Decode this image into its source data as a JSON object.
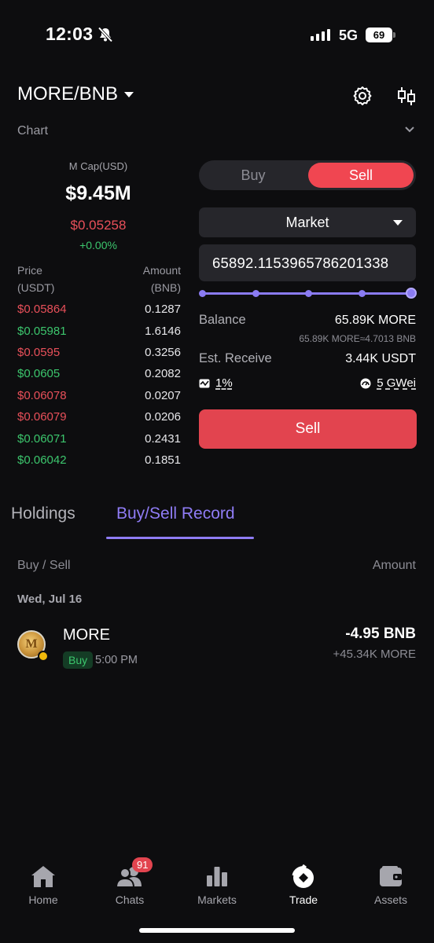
{
  "status_bar": {
    "time": "12:03",
    "network": "5G",
    "battery": "69"
  },
  "header": {
    "pair": "MORE/BNB",
    "chart_label": "Chart"
  },
  "info": {
    "mcap_label": "M Cap(USD)",
    "mcap": "$9.45M",
    "price": "$0.05258",
    "change": "+0.00%"
  },
  "orderbook": {
    "price_header_1": "Price",
    "price_header_2": "(USDT)",
    "amount_header_1": "Amount",
    "amount_header_2": "(BNB)",
    "rows": [
      {
        "price": "$0.05864",
        "amount": "0.1287",
        "side": "red"
      },
      {
        "price": "$0.05981",
        "amount": "1.6146",
        "side": "green"
      },
      {
        "price": "$0.0595",
        "amount": "0.3256",
        "side": "red"
      },
      {
        "price": "$0.0605",
        "amount": "0.2082",
        "side": "green"
      },
      {
        "price": "$0.06078",
        "amount": "0.0207",
        "side": "red"
      },
      {
        "price": "$0.06079",
        "amount": "0.0206",
        "side": "red"
      },
      {
        "price": "$0.06071",
        "amount": "0.2431",
        "side": "green"
      },
      {
        "price": "$0.06042",
        "amount": "0.1851",
        "side": "green"
      }
    ]
  },
  "trade": {
    "buy_label": "Buy",
    "sell_label": "Sell",
    "order_type": "Market",
    "amount_value": "65892.1153965786201338",
    "slider_percent": 100,
    "balance_label": "Balance",
    "balance_value": "65.89K MORE",
    "balance_sub": "65.89K MORE≈4.7013 BNB",
    "receive_label": "Est. Receive",
    "receive_value": "3.44K USDT",
    "slippage": "1%",
    "gas": "5 GWei",
    "submit_label": "Sell"
  },
  "tabs": {
    "holdings": "Holdings",
    "records": "Buy/Sell Record"
  },
  "records": {
    "col_left": "Buy / Sell",
    "col_right": "Amount",
    "date": "Wed, Jul 16",
    "items": [
      {
        "coin_letter": "M",
        "name": "MORE",
        "tag": "Buy",
        "time": "5:00 PM",
        "amount": "-4.95 BNB",
        "sub": "+45.34K MORE"
      }
    ]
  },
  "nav": {
    "chats_badge": "91",
    "items": [
      {
        "label": "Home",
        "icon": "home-icon"
      },
      {
        "label": "Chats",
        "icon": "chats-icon"
      },
      {
        "label": "Markets",
        "icon": "markets-icon"
      },
      {
        "label": "Trade",
        "icon": "trade-icon"
      },
      {
        "label": "Assets",
        "icon": "wallet-icon"
      }
    ],
    "active": "Trade"
  },
  "colors": {
    "accent": "#8f7cf5",
    "sell": "#e2444f",
    "up": "#3cc66d",
    "down": "#e9505a",
    "bg": "#0d0d0f"
  }
}
